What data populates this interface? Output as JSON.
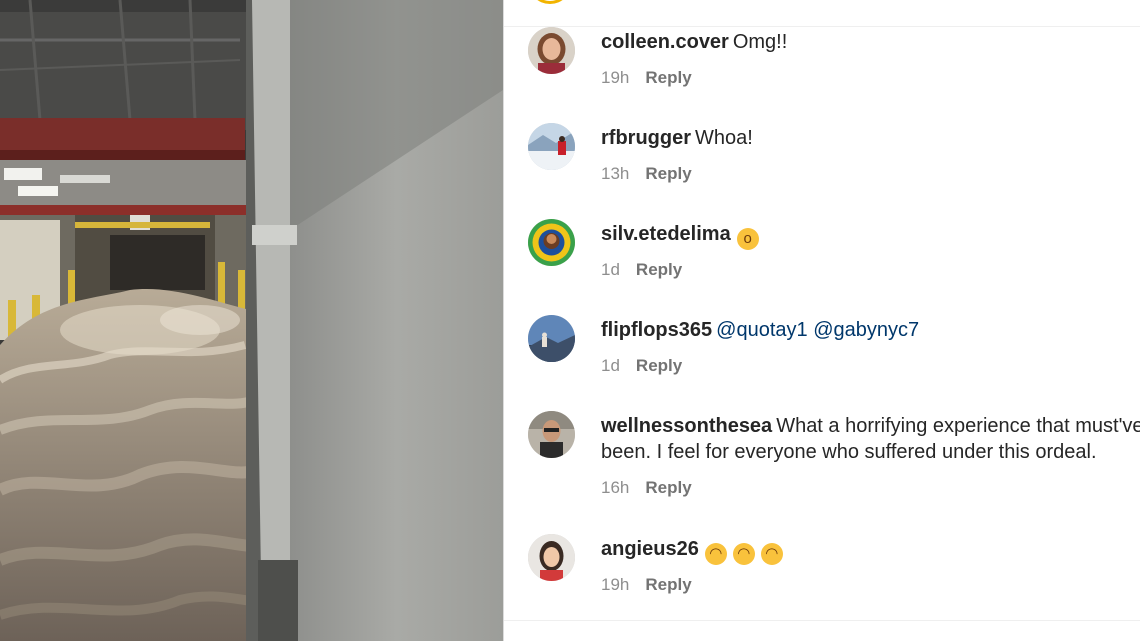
{
  "comments": [
    {
      "username": "colleen.cover",
      "text": "Omg!!",
      "time": "19h",
      "reply": "Reply",
      "avatar_icon": "profile-photo-woman"
    },
    {
      "username": "rfbrugger",
      "text": "Whoa!",
      "time": "13h",
      "reply": "Reply",
      "avatar_icon": "profile-photo-snow"
    },
    {
      "username": "silv.etedelima",
      "text": "",
      "emoji_icons": [
        "astonished-face-emoji"
      ],
      "time": "1d",
      "reply": "Reply",
      "avatar_icon": "profile-photo-illustration"
    },
    {
      "username": "flipflops365",
      "text": "",
      "mentions": [
        "@quotay1",
        "@gabynyc7"
      ],
      "time": "1d",
      "reply": "Reply",
      "avatar_icon": "profile-photo-sky"
    },
    {
      "username": "wellnessonthesea",
      "text": "What a horrifying experience that must've been. I feel for everyone who suffered under this ordeal.",
      "time": "16h",
      "reply": "Reply",
      "avatar_icon": "profile-photo-man"
    },
    {
      "username": "angieus26",
      "text": "",
      "emoji_icons": [
        "sad-face-emoji",
        "sad-face-emoji",
        "sad-face-emoji"
      ],
      "time": "19h",
      "reply": "Reply",
      "avatar_icon": "profile-photo-woman"
    }
  ],
  "colors": {
    "username": "#262626",
    "meta": "#8e8e8e",
    "mention": "#00376b",
    "emoji": "#f9c23c"
  }
}
